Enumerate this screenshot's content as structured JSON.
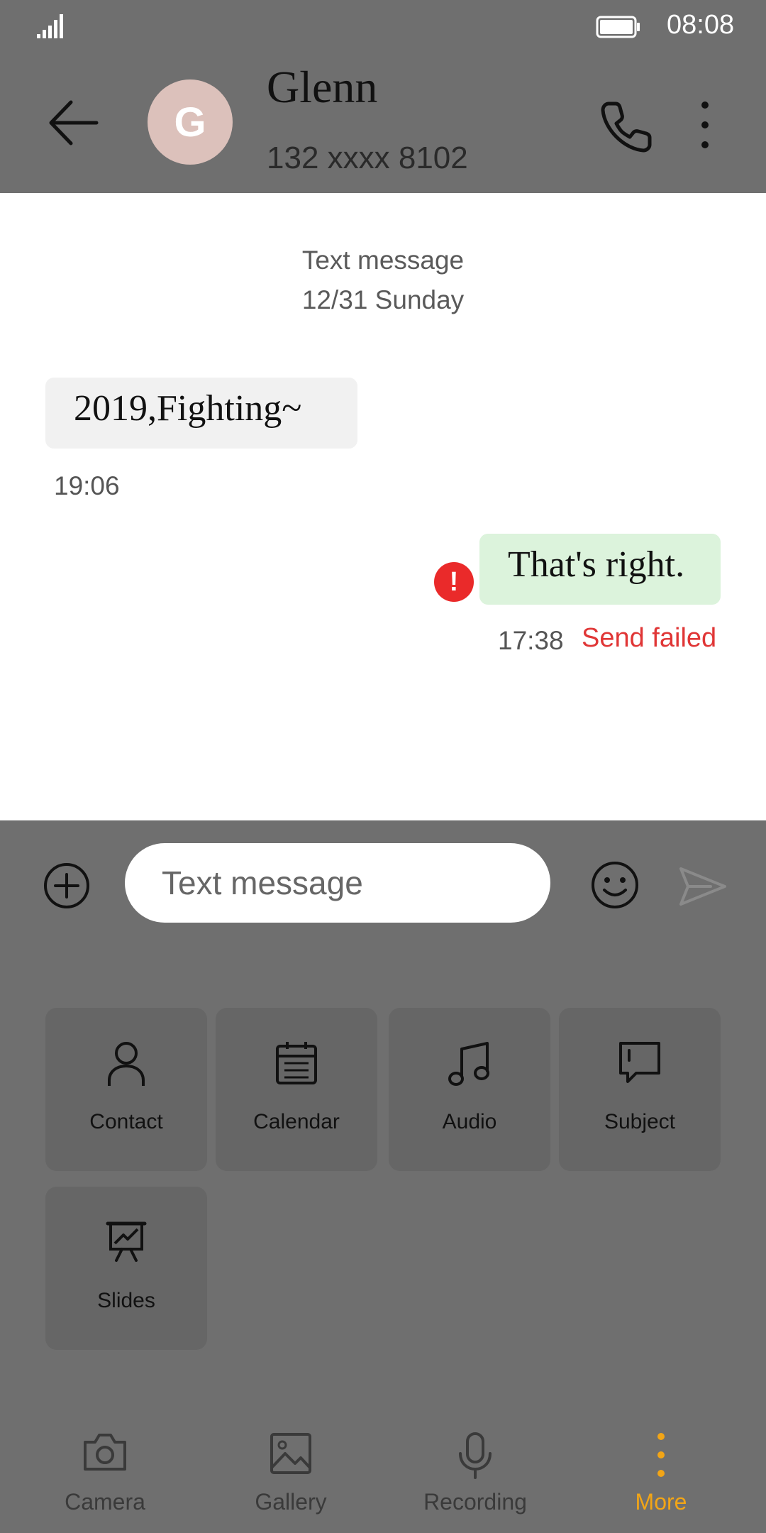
{
  "status_bar": {
    "time": "08:08",
    "battery_level": 1.0
  },
  "header": {
    "avatar_letter": "G",
    "contact_name": "Glenn",
    "contact_number": "132 xxxx 8102"
  },
  "conversation": {
    "type_label": "Text message",
    "date_label": "12/31 Sunday",
    "messages": [
      {
        "direction": "incoming",
        "text": "2019,Fighting~",
        "time": "19:06"
      },
      {
        "direction": "outgoing",
        "text": "That's right.",
        "time": "17:38",
        "status": "Send failed",
        "error_mark": "!"
      }
    ]
  },
  "composer": {
    "placeholder": "Text message"
  },
  "attachments": [
    {
      "label": "Contact",
      "icon": "person-icon"
    },
    {
      "label": "Calendar",
      "icon": "calendar-icon"
    },
    {
      "label": "Audio",
      "icon": "music-note-icon"
    },
    {
      "label": "Subject",
      "icon": "subject-icon"
    },
    {
      "label": "Slides",
      "icon": "slides-icon"
    }
  ],
  "bottom_tabs": [
    {
      "label": "Camera",
      "icon": "camera-icon"
    },
    {
      "label": "Gallery",
      "icon": "gallery-icon"
    },
    {
      "label": "Recording",
      "icon": "microphone-icon"
    },
    {
      "label": "More",
      "icon": "more-vertical-icon",
      "active": true
    }
  ],
  "colors": {
    "accent": "#f2a516",
    "error": "#e03636",
    "outgoing_bubble": "#dcf3dc",
    "incoming_bubble": "#f1f1f1",
    "avatar": "#dcc1bb"
  }
}
